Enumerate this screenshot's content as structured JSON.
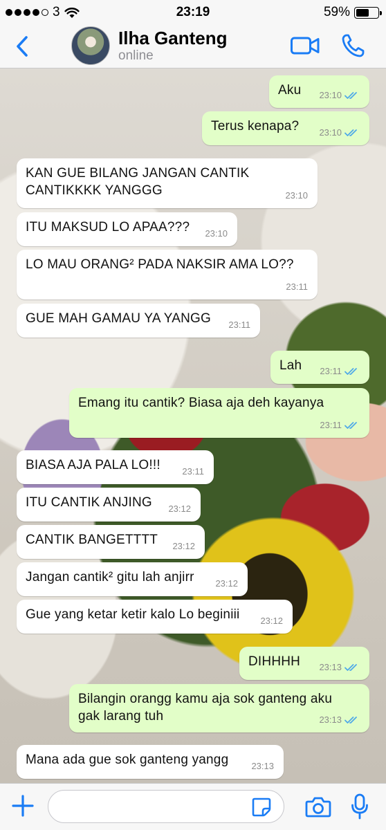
{
  "status_bar": {
    "carrier": "3",
    "time": "23:19",
    "battery": "59%",
    "battery_level": 0.59
  },
  "header": {
    "contact_name": "Ilha Ganteng",
    "contact_status": "online",
    "icons": [
      "chevron-left-icon",
      "avatar",
      "video-camera-icon",
      "phone-icon"
    ],
    "accent_color": "#1a7cf5"
  },
  "colors": {
    "incoming_bubble": "#ffffff",
    "outgoing_bubble": "#e2fec8",
    "read_tick": "#4fa9e8"
  },
  "messages": [
    {
      "dir": "out",
      "text": "Aku",
      "time": "23:10",
      "read": true
    },
    {
      "dir": "out",
      "text": "Terus kenapa?",
      "time": "23:10",
      "read": true
    },
    {
      "dir": "in",
      "text": "KAN GUE BILANG JANGAN CANTIK CANTIKKKK YANGGG",
      "time": "23:10"
    },
    {
      "dir": "in",
      "text": "ITU MAKSUD LO APAA???",
      "time": "23:10"
    },
    {
      "dir": "in",
      "text": "LO MAU ORANG² PADA NAKSIR AMA LO??",
      "time": "23:11"
    },
    {
      "dir": "in",
      "text": "GUE MAH GAMAU YA YANGG",
      "time": "23:11"
    },
    {
      "dir": "out",
      "text": "Lah",
      "time": "23:11",
      "read": true
    },
    {
      "dir": "out",
      "text": "Emang itu cantik? Biasa aja deh kayanya",
      "time": "23:11",
      "read": true
    },
    {
      "dir": "in",
      "text": "BIASA AJA PALA LO!!!",
      "time": "23:11"
    },
    {
      "dir": "in",
      "text": "ITU CANTIK ANJING",
      "time": "23:12"
    },
    {
      "dir": "in",
      "text": "CANTIK BANGETTTT",
      "time": "23:12"
    },
    {
      "dir": "in",
      "text": "Jangan cantik² gitu lah anjirr",
      "time": "23:12"
    },
    {
      "dir": "in",
      "text": "Gue yang ketar ketir kalo Lo beginiii",
      "time": "23:12"
    },
    {
      "dir": "out",
      "text": "DIHHHH",
      "time": "23:13",
      "read": true
    },
    {
      "dir": "out",
      "text": "Bilangin orangg kamu aja sok ganteng aku gak larang tuh",
      "time": "23:13",
      "read": true
    },
    {
      "dir": "in",
      "text": "Mana ada gue sok ganteng yangg",
      "time": "23:13"
    }
  ],
  "input_bar": {
    "placeholder": "",
    "icons": [
      "plus-icon",
      "sticker-icon",
      "camera-icon",
      "microphone-icon"
    ]
  }
}
